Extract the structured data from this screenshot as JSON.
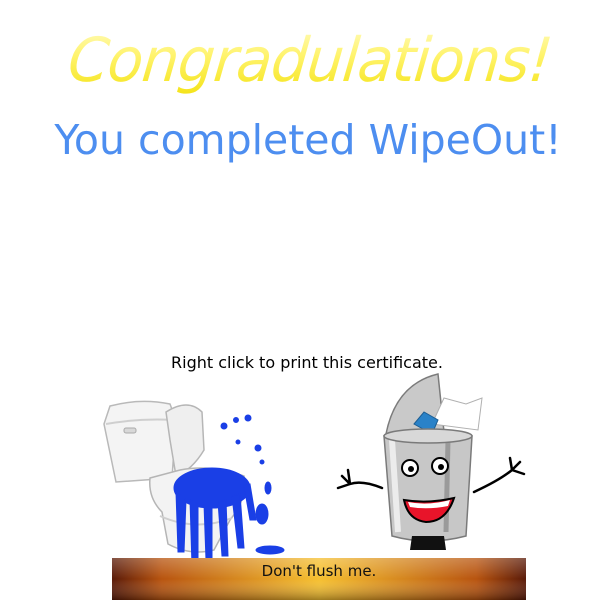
{
  "certificate": {
    "heading": "Congradulations!",
    "subheading": "You completed WipeOut!",
    "print_hint": "Right click to print this certificate."
  },
  "plaque": {
    "label": "Don't flush me."
  },
  "colors": {
    "heading_yellow": "#fff36a",
    "subheading_blue": "#4d8ef0",
    "splash_blue": "#1a3fe6",
    "plaque_gold": "#f2b21a",
    "plaque_brown": "#5a1a08"
  },
  "icons": [
    "toilet-icon",
    "trash-can-character-icon"
  ]
}
